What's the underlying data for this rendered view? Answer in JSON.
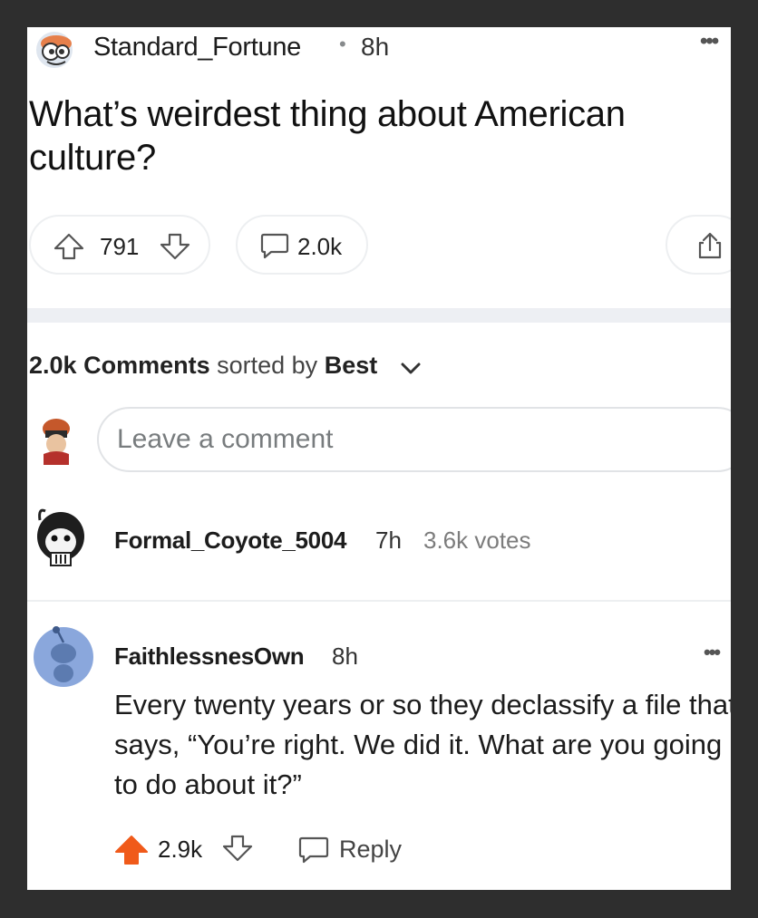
{
  "post": {
    "author": "Standard_Fortune",
    "separator": "•",
    "age": "8h",
    "more_label": "•••",
    "title": "What’s weirdest thing about American culture?",
    "upvotes": "791",
    "comments_count": "2.0k"
  },
  "sort_bar": {
    "count": "2.0k",
    "comments_label": "Comments",
    "sorted_by": "sorted by",
    "sort_value": "Best"
  },
  "comment_input": {
    "placeholder": "Leave a comment"
  },
  "comments": [
    {
      "author": "Formal_Coyote_5004",
      "age": "7h",
      "votes": "3.6k votes"
    },
    {
      "author": "FaithlessnesOwn",
      "age": "8h",
      "more_label": "•••",
      "body": "Every twenty years or so they declassify a file that says, “You’re right. We did it. What are you going to do about it?”",
      "score": "2.9k",
      "reply_label": "Reply"
    }
  ],
  "colors": {
    "upvote_active": "#f05a1a",
    "divider": "#edeff3",
    "muted_text": "#787c7e"
  },
  "icons": {
    "upvote": "arrow-up-icon",
    "downvote": "arrow-down-icon",
    "comment": "speech-bubble-icon",
    "share": "share-icon",
    "chevron": "chevron-down-icon",
    "more": "more-dots-icon"
  }
}
